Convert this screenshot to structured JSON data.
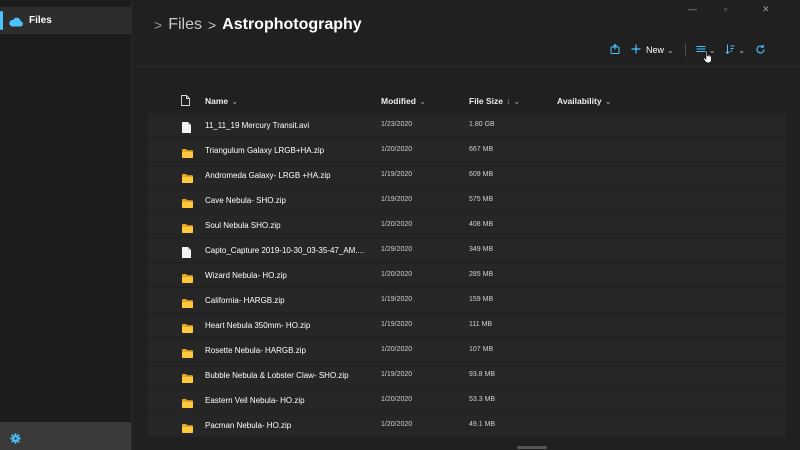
{
  "sidebar": {
    "items": [
      {
        "label": "Files",
        "icon": "cloud-icon"
      }
    ],
    "settings_icon": "gear-icon",
    "accent_color": "#4cc2ff"
  },
  "window_controls": {
    "minimize": "—",
    "maximize": "▫",
    "close": "✕"
  },
  "breadcrumb": {
    "items": [
      "Files",
      "Astrophotography"
    ]
  },
  "toolbar": {
    "new_label": "New",
    "accent_color": "#4cc2ff",
    "icons": [
      "share-icon",
      "plus-icon",
      "view-options-icon",
      "sort-icon",
      "refresh-icon"
    ]
  },
  "table": {
    "columns": [
      {
        "label": "Name"
      },
      {
        "label": "Modified"
      },
      {
        "label": "File Size"
      },
      {
        "label": "Availability"
      }
    ],
    "rows": [
      {
        "name": "11_11_19 Mercury Transit.avi",
        "modified": "1/23/2020",
        "size": "1.80 GB",
        "type": "file"
      },
      {
        "name": "Triangulum Galaxy LRGB+HA.zip",
        "modified": "1/20/2020",
        "size": "667 MB",
        "type": "folder"
      },
      {
        "name": "Andromeda Galaxy- LRGB +HA.zip",
        "modified": "1/19/2020",
        "size": "609 MB",
        "type": "folder"
      },
      {
        "name": "Cave Nebula- SHO.zip",
        "modified": "1/19/2020",
        "size": "575 MB",
        "type": "folder"
      },
      {
        "name": "Soul Nebula SHO.zip",
        "modified": "1/20/2020",
        "size": "408 MB",
        "type": "folder"
      },
      {
        "name": "Capto_Capture 2019-10-30_03-35-47_AM....",
        "modified": "1/29/2020",
        "size": "349 MB",
        "type": "file"
      },
      {
        "name": "Wizard Nebula- HO.zip",
        "modified": "1/20/2020",
        "size": "285 MB",
        "type": "folder"
      },
      {
        "name": "California- HARGB.zip",
        "modified": "1/19/2020",
        "size": "159 MB",
        "type": "folder"
      },
      {
        "name": "Heart Nebula 350mm- HO.zip",
        "modified": "1/19/2020",
        "size": "111 MB",
        "type": "folder"
      },
      {
        "name": "Rosette Nebula- HARGB.zip",
        "modified": "1/20/2020",
        "size": "107 MB",
        "type": "folder"
      },
      {
        "name": "Bubble Nebula & Lobster Claw- SHO.zip",
        "modified": "1/19/2020",
        "size": "93.8 MB",
        "type": "folder"
      },
      {
        "name": "Eastern Veil Nebula- HO.zip",
        "modified": "1/20/2020",
        "size": "53.3 MB",
        "type": "folder"
      },
      {
        "name": "Pacman Nebula- HO.zip",
        "modified": "1/20/2020",
        "size": "49.1 MB",
        "type": "folder"
      }
    ]
  }
}
